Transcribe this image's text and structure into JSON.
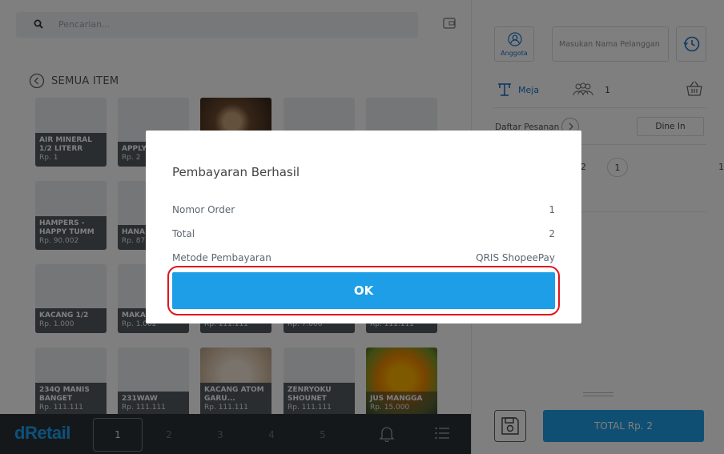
{
  "search": {
    "placeholder": "Pencarian..."
  },
  "category": {
    "back_label": "SEMUA ITEM"
  },
  "items": [
    {
      "name": "AIR MINERAL 1/2 LITERR",
      "price": "Rp. 1"
    },
    {
      "name": "APPLY 1234",
      "price": "Rp. 2"
    },
    {
      "name": "",
      "price": ""
    },
    {
      "name": "",
      "price": ""
    },
    {
      "name": "",
      "price": ""
    },
    {
      "name": "HAMPERS - HAPPY TUMM",
      "price": "Rp. 90.002"
    },
    {
      "name": "HANA TIMES",
      "price": "Rp. 87"
    },
    {
      "name": "KACANG 1/2",
      "price": "Rp. 1.000"
    },
    {
      "name": "MAKA 1/2 R",
      "price": "Rp. 1.002"
    },
    {
      "name": "",
      "price": "Rp. 111.111"
    },
    {
      "name": "",
      "price": "Rp. 7.000"
    },
    {
      "name": "",
      "price": "Rp. 111.111"
    },
    {
      "name": "234Q MANIS BANGET",
      "price": "Rp. 111.111"
    },
    {
      "name": "231WAW",
      "price": "Rp. 111.111"
    },
    {
      "name": "KACANG ATOM GARU...",
      "price": "Rp. 111.111"
    },
    {
      "name": "ZENRYOKU SHOUNET",
      "price": "Rp. 111.111"
    },
    {
      "name": "JUS MANGGA",
      "price": "Rp. 15.000"
    }
  ],
  "bottom_bar": {
    "logo": "dRetail",
    "pages": [
      "1",
      "2",
      "3",
      "4",
      "5"
    ],
    "active_page": "1"
  },
  "right_panel": {
    "member_label": "Anggota",
    "name_placeholder": "Masukan Nama Pelanggan",
    "table_label": "Meja",
    "people_count": "1",
    "order_list_label": "Daftar Pesanan",
    "dine_in_label": "Dine In",
    "item_qty_text": "2",
    "item_qty_box": "1",
    "item_price": "1",
    "total_label": "TOTAL Rp. 2"
  },
  "dialog": {
    "title": "Pembayaran Berhasil",
    "rows": [
      {
        "label": "Nomor Order",
        "value": "1"
      },
      {
        "label": "Total",
        "value": "2"
      },
      {
        "label": "Metode Pembayaran",
        "value": "QRIS ShopeePay"
      }
    ],
    "ok_label": "OK"
  },
  "colors": {
    "primary": "#1e9ee6",
    "highlight_ring": "#e0151e",
    "bottom_bar": "#2b3137",
    "tile_caption": "#555b61"
  },
  "icons": [
    "search-icon",
    "cash-drawer-icon",
    "back-circle-icon",
    "bell-icon",
    "menu-list-icon",
    "member-icon",
    "history-icon",
    "table-icon",
    "people-icon",
    "basket-icon",
    "chevron-right-icon",
    "save-icon"
  ]
}
